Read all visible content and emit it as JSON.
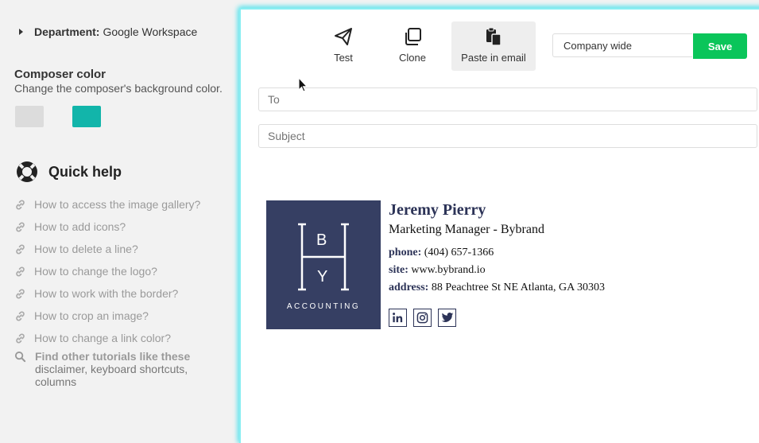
{
  "sidebar": {
    "department_label": "Department:",
    "department_value": "Google Workspace",
    "composer_color_title": "Composer color",
    "composer_color_desc": "Change the composer's background color.",
    "swatches": [
      "#dcdcdc",
      "#12b5aa"
    ],
    "quick_help_title": "Quick help",
    "help_items": [
      "How to access the image gallery?",
      "How to add icons?",
      "How to delete a line?",
      "How to change the logo?",
      "How to work with the border?",
      "How to crop an image?",
      "How to change a link color?"
    ],
    "find_title": "Find other tutorials like these",
    "find_links": "disclaimer, keyboard shortcuts, columns"
  },
  "toolbar": {
    "test_label": "Test",
    "clone_label": "Clone",
    "paste_label": "Paste in email",
    "scope_value": "Company wide",
    "save_label": "Save"
  },
  "composer": {
    "to_placeholder": "To",
    "subject_placeholder": "Subject"
  },
  "signature": {
    "logo": {
      "letters": [
        "B",
        "Y"
      ],
      "text": "ACCOUNTING",
      "color": "#363f63"
    },
    "name": "Jeremy Pierry",
    "title": "Marketing Manager - Bybrand",
    "phone_label": "phone:",
    "phone": "(404) 657-1366",
    "site_label": "site:",
    "site": "www.bybrand.io",
    "address_label": "address:",
    "address": "88 Peachtree St NE Atlanta, GA 30303",
    "social": [
      "linkedin-icon",
      "instagram-icon",
      "twitter-icon"
    ]
  },
  "colors": {
    "accent": "#0ac55a",
    "brand_navy": "#2c3357",
    "teal": "#12b5aa"
  }
}
